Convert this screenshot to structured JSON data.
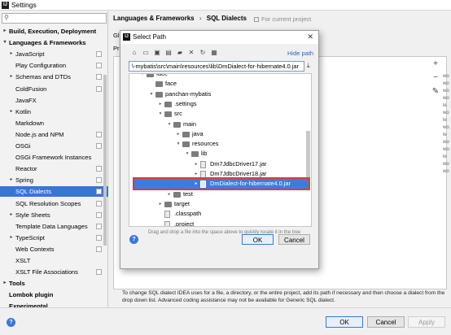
{
  "window": {
    "title": "Settings",
    "app_icon": "IJ"
  },
  "search": {
    "value": "",
    "placeholder": ""
  },
  "sidebar": {
    "items": [
      {
        "label": "Build, Execution, Deployment",
        "bold": true,
        "arrow": "▸",
        "level": 0
      },
      {
        "label": "Languages & Frameworks",
        "bold": true,
        "arrow": "▾",
        "level": 0
      },
      {
        "label": "JavaScript",
        "arrow": "▸",
        "level": 1,
        "cfg": true
      },
      {
        "label": "Play Configuration",
        "level": 1,
        "cfg": true
      },
      {
        "label": "Schemas and DTDs",
        "arrow": "▸",
        "level": 1,
        "cfg": true
      },
      {
        "label": "ColdFusion",
        "level": 1,
        "cfg": true
      },
      {
        "label": "JavaFX",
        "level": 1
      },
      {
        "label": "Kotlin",
        "arrow": "▸",
        "level": 1
      },
      {
        "label": "Markdown",
        "level": 1
      },
      {
        "label": "Node.js and NPM",
        "level": 1,
        "cfg": true
      },
      {
        "label": "OSGi",
        "level": 1,
        "cfg": true
      },
      {
        "label": "OSGi Framework Instances",
        "level": 1
      },
      {
        "label": "Reactor",
        "level": 1,
        "cfg": true
      },
      {
        "label": "Spring",
        "arrow": "▸",
        "level": 1,
        "cfg": true
      },
      {
        "label": "SQL Dialects",
        "level": 1,
        "cfg": true,
        "selected": true
      },
      {
        "label": "SQL Resolution Scopes",
        "level": 1,
        "cfg": true
      },
      {
        "label": "Style Sheets",
        "arrow": "▸",
        "level": 1,
        "cfg": true
      },
      {
        "label": "Template Data Languages",
        "level": 1,
        "cfg": true
      },
      {
        "label": "TypeScript",
        "arrow": "▸",
        "level": 1,
        "cfg": true
      },
      {
        "label": "Web Contexts",
        "level": 1,
        "cfg": true
      },
      {
        "label": "XSLT",
        "level": 1
      },
      {
        "label": "XSLT File Associations",
        "level": 1,
        "cfg": true
      },
      {
        "label": "Tools",
        "bold": true,
        "arrow": "▸",
        "level": 0
      },
      {
        "label": "Lombok plugin",
        "bold": true,
        "level": 0
      },
      {
        "label": "Experimental",
        "bold": true,
        "level": 0
      }
    ]
  },
  "header": {
    "breadcrumb_parent": "Languages & Frameworks",
    "breadcrumb_sep": "›",
    "breadcrumb_current": "SQL Dialects",
    "for_project": "For current project"
  },
  "content": {
    "clipped_label_1": "Gl",
    "clipped_label_2": "Pr",
    "hint": "To change SQL dialect IDEA uses for a file, a directory, or the entire project, add its path if necessary and then choose a dialect from the drop down list. Advanced coding assistance may not be available for Generic SQL dialect.",
    "edge_text": "wo wo wo wo le wo le wo le wo wo le wo wo"
  },
  "dialog": {
    "title": "Select Path",
    "close": "✕",
    "hide_path": "Hide path",
    "path_value": "\\-mybatis\\src\\main\\resources\\lib\\DmDialect-for-hibernate4.0.jar",
    "drag_hint": "Drag and drop a file into the space above to quickly locate it in the tree",
    "ok": "OK",
    "cancel": "Cancel",
    "tree": [
      {
        "label": "face",
        "type": "folder",
        "arrow": "▾",
        "depth": 0
      },
      {
        "label": "face",
        "type": "folder",
        "arrow": "",
        "depth": 1
      },
      {
        "label": "panchan-mybatis",
        "type": "folder",
        "arrow": "▾",
        "depth": 1
      },
      {
        "label": ".settings",
        "type": "folder",
        "arrow": "▸",
        "depth": 2
      },
      {
        "label": "src",
        "type": "folder",
        "arrow": "▾",
        "depth": 2
      },
      {
        "label": "main",
        "type": "folder",
        "arrow": "▾",
        "depth": 3
      },
      {
        "label": "java",
        "type": "folder",
        "arrow": "▸",
        "depth": 4
      },
      {
        "label": "resources",
        "type": "folder",
        "arrow": "▾",
        "depth": 4
      },
      {
        "label": "lib",
        "type": "folder",
        "arrow": "▾",
        "depth": 5
      },
      {
        "label": "Dm7JdbcDriver17.jar",
        "type": "file",
        "arrow": "▸",
        "depth": 6
      },
      {
        "label": "Dm7JdbcDriver18.jar",
        "type": "file",
        "arrow": "▸",
        "depth": 6
      },
      {
        "label": "DmDialect-for-hibernate4.0.jar",
        "type": "file",
        "arrow": "▸",
        "depth": 6,
        "selected": true
      },
      {
        "label": "test",
        "type": "folder",
        "arrow": "▸",
        "depth": 3
      },
      {
        "label": "target",
        "type": "folder",
        "arrow": "▸",
        "depth": 2
      },
      {
        "label": ".classpath",
        "type": "file",
        "arrow": "",
        "depth": 2
      },
      {
        "label": ".project",
        "type": "file",
        "arrow": "",
        "depth": 2
      }
    ]
  },
  "buttons": {
    "ok": "OK",
    "cancel": "Cancel",
    "apply": "Apply",
    "help": "?"
  },
  "colors": {
    "selection": "#3875d7",
    "highlight_box": "#e53935",
    "link": "#2a63c7"
  }
}
